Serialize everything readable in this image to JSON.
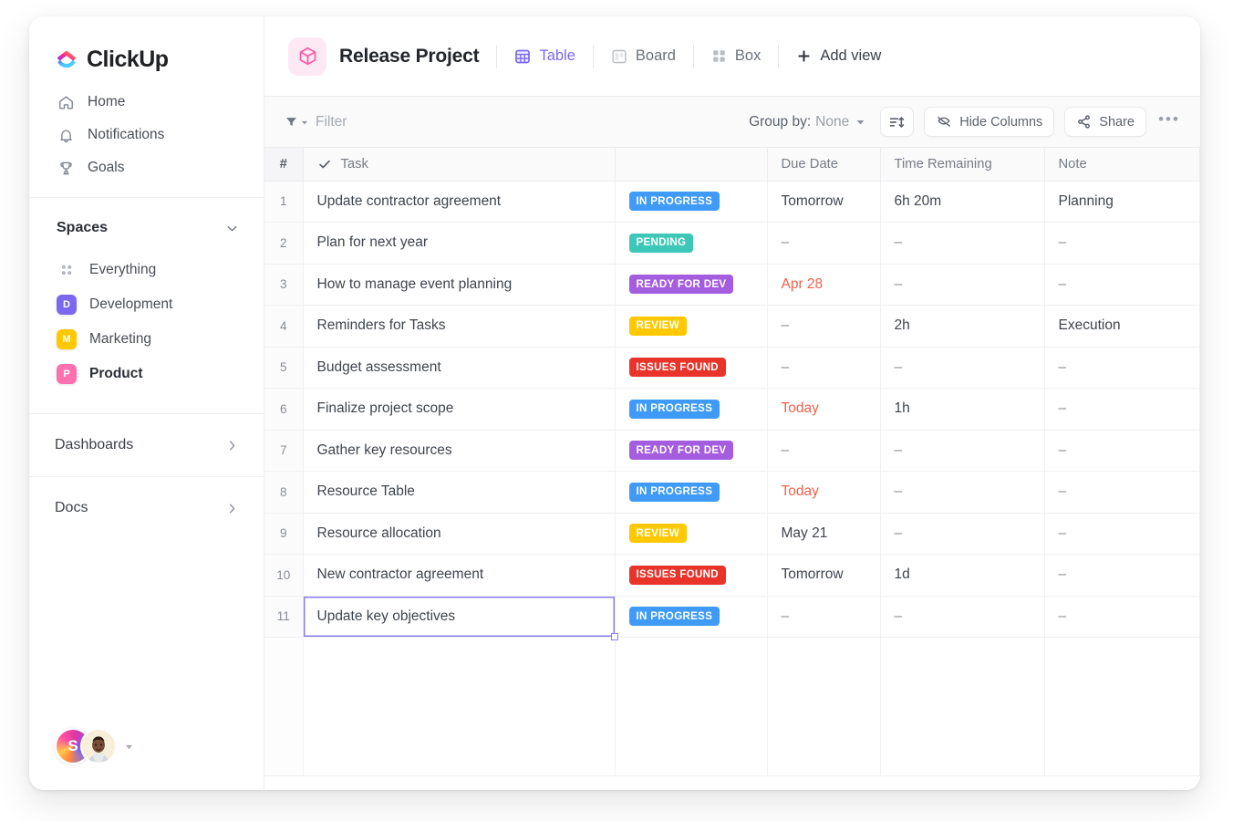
{
  "sidebar": {
    "brand": {
      "name": "ClickUp",
      "logo_icon": "clickup-logo-icon"
    },
    "nav": [
      {
        "label": "Home",
        "icon": "home-icon"
      },
      {
        "label": "Notifications",
        "icon": "bell-icon"
      },
      {
        "label": "Goals",
        "icon": "trophy-icon"
      }
    ],
    "spaces_section": {
      "title": "Spaces",
      "chevron_icon": "chevron-down-icon"
    },
    "spaces": [
      {
        "label": "Everything",
        "icon": "grid-dots-icon",
        "initial": "",
        "color": ""
      },
      {
        "label": "Development",
        "icon": "space-badge",
        "initial": "D",
        "color": "#7b68ee"
      },
      {
        "label": "Marketing",
        "icon": "space-badge",
        "initial": "M",
        "color": "#ffc800"
      },
      {
        "label": "Product",
        "icon": "space-badge",
        "initial": "P",
        "color": "#fd71af",
        "active": true
      }
    ],
    "expanders": [
      {
        "label": "Dashboards",
        "icon": "chevron-right-icon"
      },
      {
        "label": "Docs",
        "icon": "chevron-right-icon"
      }
    ],
    "footer": {
      "avatar_initial": "S",
      "avatar_photo_name": "user-photo-avatar",
      "caret_icon": "caret-down-icon"
    }
  },
  "header": {
    "project_icon": "pink-cube-icon",
    "title": "Release Project",
    "views": [
      {
        "label": "Table",
        "icon": "table-icon",
        "active": true
      },
      {
        "label": "Board",
        "icon": "board-icon",
        "active": false
      },
      {
        "label": "Box",
        "icon": "box-icon",
        "active": false
      }
    ],
    "add_view": {
      "label": "Add view",
      "icon": "plus-icon"
    }
  },
  "toolbar": {
    "filter": {
      "label": "Filter",
      "icon": "funnel-icon",
      "caret_icon": "caret-down-icon"
    },
    "group_by": {
      "key": "Group by:",
      "value": "None",
      "caret_icon": "caret-down-icon"
    },
    "sort": {
      "label": "",
      "icon": "sort-icon"
    },
    "hide_columns": {
      "label": "Hide Columns",
      "icon": "eye-slash-icon"
    },
    "share": {
      "label": "Share",
      "icon": "share-icon"
    },
    "more": {
      "label": "•••",
      "icon": "ellipsis-icon"
    }
  },
  "table": {
    "columns": [
      {
        "key": "idx",
        "label": "#"
      },
      {
        "key": "task",
        "label": "Task",
        "icon": "check-icon"
      },
      {
        "key": "status",
        "label": ""
      },
      {
        "key": "due",
        "label": "Due Date"
      },
      {
        "key": "time",
        "label": "Time Remaining"
      },
      {
        "key": "note",
        "label": "Note"
      }
    ],
    "status_colors": {
      "IN PROGRESS": "#3f9bf7",
      "PENDING": "#3dc7b8",
      "READY FOR DEV": "#a45ddf",
      "REVIEW": "#ffc800",
      "ISSUES FOUND": "#e8342a"
    },
    "selected_cell": {
      "row": 11,
      "column": "task"
    },
    "rows": [
      {
        "idx": "1",
        "task": "Update contractor agreement",
        "status": "IN PROGRESS",
        "due": "Tomorrow",
        "due_overdue": false,
        "time": "6h 20m",
        "note": "Planning"
      },
      {
        "idx": "2",
        "task": "Plan for next year",
        "status": "PENDING",
        "due": "–",
        "due_overdue": false,
        "time": "–",
        "note": "–"
      },
      {
        "idx": "3",
        "task": "How to manage event planning",
        "status": "READY FOR DEV",
        "due": "Apr 28",
        "due_overdue": true,
        "time": "–",
        "note": "–"
      },
      {
        "idx": "4",
        "task": "Reminders for Tasks",
        "status": "REVIEW",
        "due": "–",
        "due_overdue": false,
        "time": "2h",
        "note": "Execution"
      },
      {
        "idx": "5",
        "task": "Budget assessment",
        "status": "ISSUES FOUND",
        "due": "–",
        "due_overdue": false,
        "time": "–",
        "note": "–"
      },
      {
        "idx": "6",
        "task": "Finalize project scope",
        "status": "IN PROGRESS",
        "due": "Today",
        "due_overdue": true,
        "time": "1h",
        "note": "–"
      },
      {
        "idx": "7",
        "task": "Gather key resources",
        "status": "READY FOR DEV",
        "due": "–",
        "due_overdue": false,
        "time": "–",
        "note": "–"
      },
      {
        "idx": "8",
        "task": "Resource Table",
        "status": "IN PROGRESS",
        "due": "Today",
        "due_overdue": true,
        "time": "–",
        "note": "–"
      },
      {
        "idx": "9",
        "task": "Resource allocation",
        "status": "REVIEW",
        "due": "May 21",
        "due_overdue": false,
        "time": "–",
        "note": "–"
      },
      {
        "idx": "10",
        "task": "New contractor agreement",
        "status": "ISSUES FOUND",
        "due": "Tomorrow",
        "due_overdue": false,
        "time": "1d",
        "note": "–"
      },
      {
        "idx": "11",
        "task": "Update key objectives",
        "status": "IN PROGRESS",
        "due": "–",
        "due_overdue": false,
        "time": "–",
        "note": "–"
      }
    ]
  },
  "theme": {
    "accent_purple": "#7b68ee",
    "brand_pink": "#fd71af",
    "overdue_red": "#f1604c",
    "border": "#eef0f2",
    "toolbar_bg": "#fafafb"
  }
}
